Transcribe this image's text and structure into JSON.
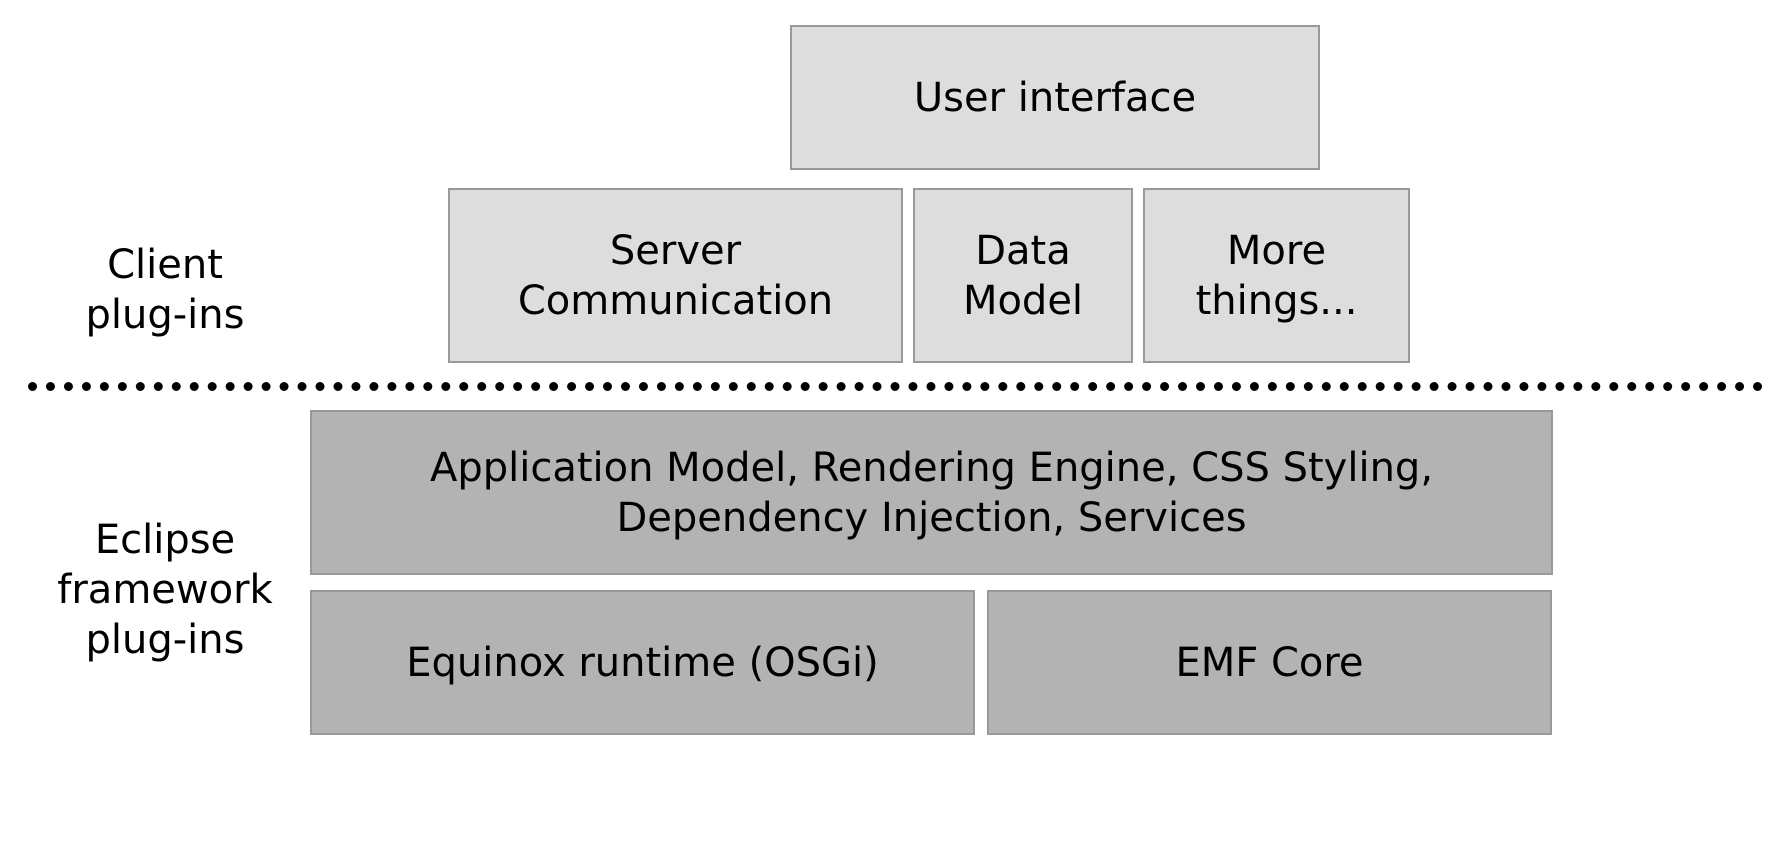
{
  "labels": {
    "client": "Client\nplug-ins",
    "eclipse": "Eclipse\nframework\nplug-ins"
  },
  "client_layer": {
    "ui": "User interface",
    "server": "Server\nCommunication",
    "data": "Data\nModel",
    "more": "More\nthings..."
  },
  "framework_layer": {
    "app_model": "Application Model, Rendering Engine, CSS Styling,\nDependency Injection, Services",
    "equinox": "Equinox runtime (OSGi)",
    "emf": "EMF Core"
  }
}
